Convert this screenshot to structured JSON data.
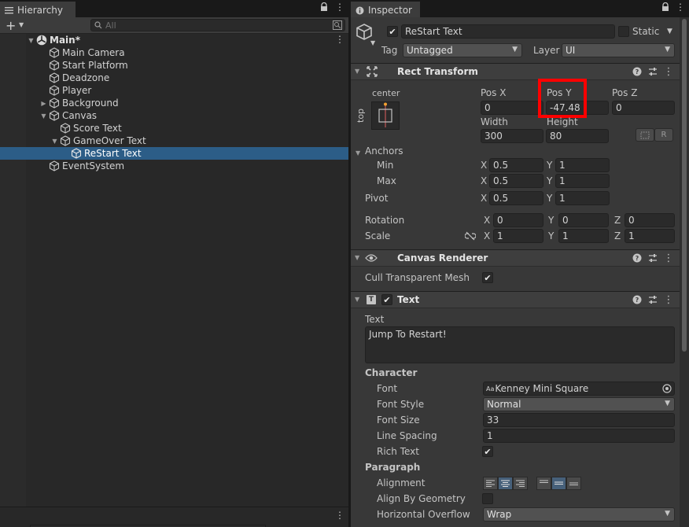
{
  "hierarchy": {
    "tab_label": "Hierarchy",
    "search_placeholder": "All",
    "items": [
      {
        "label": "Main*"
      },
      {
        "label": "Main Camera"
      },
      {
        "label": "Start Platform"
      },
      {
        "label": "Deadzone"
      },
      {
        "label": "Player"
      },
      {
        "label": "Background"
      },
      {
        "label": "Canvas"
      },
      {
        "label": "Score Text"
      },
      {
        "label": "GameOver Text"
      },
      {
        "label": "ReStart Text"
      },
      {
        "label": "EventSystem"
      }
    ]
  },
  "inspector": {
    "tab_label": "Inspector",
    "object_name": "ReStart Text",
    "static_label": "Static",
    "tag_label": "Tag",
    "tag_value": "Untagged",
    "layer_label": "Layer",
    "layer_value": "UI",
    "rect_transform": {
      "title": "Rect Transform",
      "anchor_preset_h": "center",
      "anchor_preset_v": "top",
      "pos_x_label": "Pos X",
      "pos_x": "0",
      "pos_y_label": "Pos Y",
      "pos_y": "-47.48",
      "pos_z_label": "Pos Z",
      "pos_z": "0",
      "width_label": "Width",
      "width": "300",
      "height_label": "Height",
      "height": "80",
      "raw_button": "R",
      "anchors_label": "Anchors",
      "min_label": "Min",
      "min_x": "0.5",
      "min_y": "1",
      "max_label": "Max",
      "max_x": "0.5",
      "max_y": "1",
      "pivot_label": "Pivot",
      "pivot_x": "0.5",
      "pivot_y": "1",
      "rotation_label": "Rotation",
      "rot_x": "0",
      "rot_y": "0",
      "rot_z": "0",
      "scale_label": "Scale",
      "scale_x": "1",
      "scale_y": "1",
      "scale_z": "1",
      "x": "X",
      "y": "Y",
      "z": "Z"
    },
    "canvas_renderer": {
      "title": "Canvas Renderer",
      "cull_label": "Cull Transparent Mesh"
    },
    "text": {
      "title": "Text",
      "text_label": "Text",
      "text_value": "Jump To Restart!",
      "character_label": "Character",
      "font_label": "Font",
      "font_value": "Kenney Mini Square",
      "font_prefix": "Aa",
      "font_style_label": "Font Style",
      "font_style_value": "Normal",
      "font_size_label": "Font Size",
      "font_size_value": "33",
      "line_spacing_label": "Line Spacing",
      "line_spacing_value": "1",
      "rich_text_label": "Rich Text",
      "paragraph_label": "Paragraph",
      "alignment_label": "Alignment",
      "align_by_geometry_label": "Align By Geometry",
      "horizontal_overflow_label": "Horizontal Overflow",
      "horizontal_overflow_value": "Wrap"
    }
  },
  "colors": {
    "selection": "#2c5d87",
    "highlight": "#ff0000",
    "panel": "#383838",
    "field": "#2a2a2a"
  }
}
